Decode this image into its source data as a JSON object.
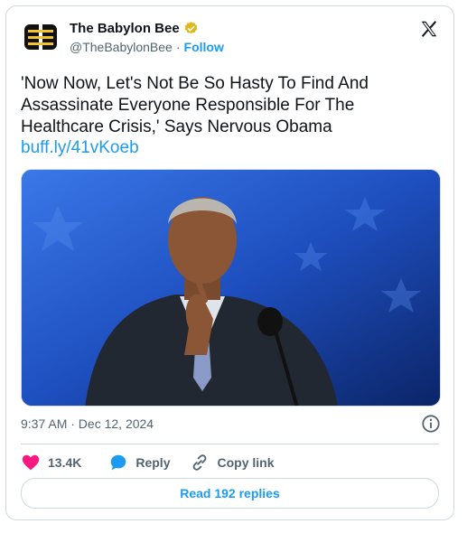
{
  "header": {
    "display_name": "The Babylon Bee",
    "handle": "@TheBabylonBee",
    "separator": "·",
    "follow_label": "Follow"
  },
  "tweet": {
    "text": "'Now Now, Let's Not Be So Hasty To Find And Assassinate Everyone Responsible For The Healthcare Crisis,' Says Nervous Obama",
    "link": "buff.ly/41vKoeb",
    "timestamp": "9:37 AM · Dec 12, 2024"
  },
  "actions": {
    "likes_count": "13.4K",
    "reply_label": "Reply",
    "copy_link_label": "Copy link"
  },
  "footer": {
    "read_replies_label": "Read 192 replies"
  },
  "colors": {
    "accent": "#1d9bf0",
    "like": "#f91880",
    "verified": "#e2b719"
  },
  "icons": {
    "avatar": "babylon-bee-logo",
    "verified": "gold-verified-badge-icon",
    "brand": "x-logo-icon",
    "info": "info-icon",
    "like": "heart-icon",
    "reply": "speech-bubble-icon",
    "copy": "link-icon"
  }
}
